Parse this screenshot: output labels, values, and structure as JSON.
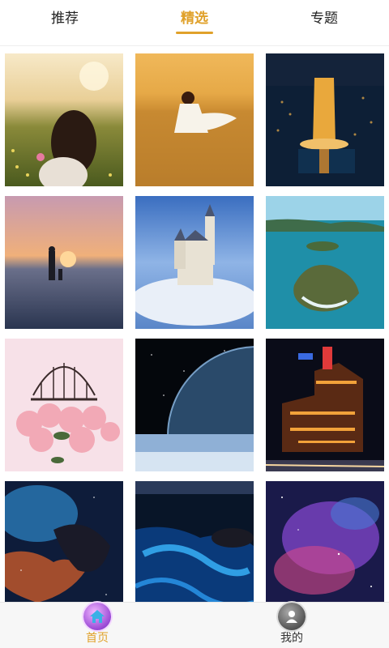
{
  "tabs": [
    {
      "label": "推荐",
      "active": false
    },
    {
      "label": "精选",
      "active": true
    },
    {
      "label": "专题",
      "active": false
    }
  ],
  "accent_color": "#e0a12a",
  "gallery": [
    "sunset-field-girl",
    "wheat-field-dancer",
    "night-city-tower",
    "beach-sunset-couple",
    "castle-above-clouds",
    "tropical-islands",
    "rose-birdcage",
    "earth-from-space",
    "night-palace-lights",
    "nebula-cliffs",
    "glowing-bioluminescent-shore",
    "purple-galaxy-nebula"
  ],
  "bottom_nav": [
    {
      "label": "首页",
      "icon": "home-icon",
      "active": true
    },
    {
      "label": "我的",
      "icon": "user-icon",
      "active": false
    }
  ]
}
